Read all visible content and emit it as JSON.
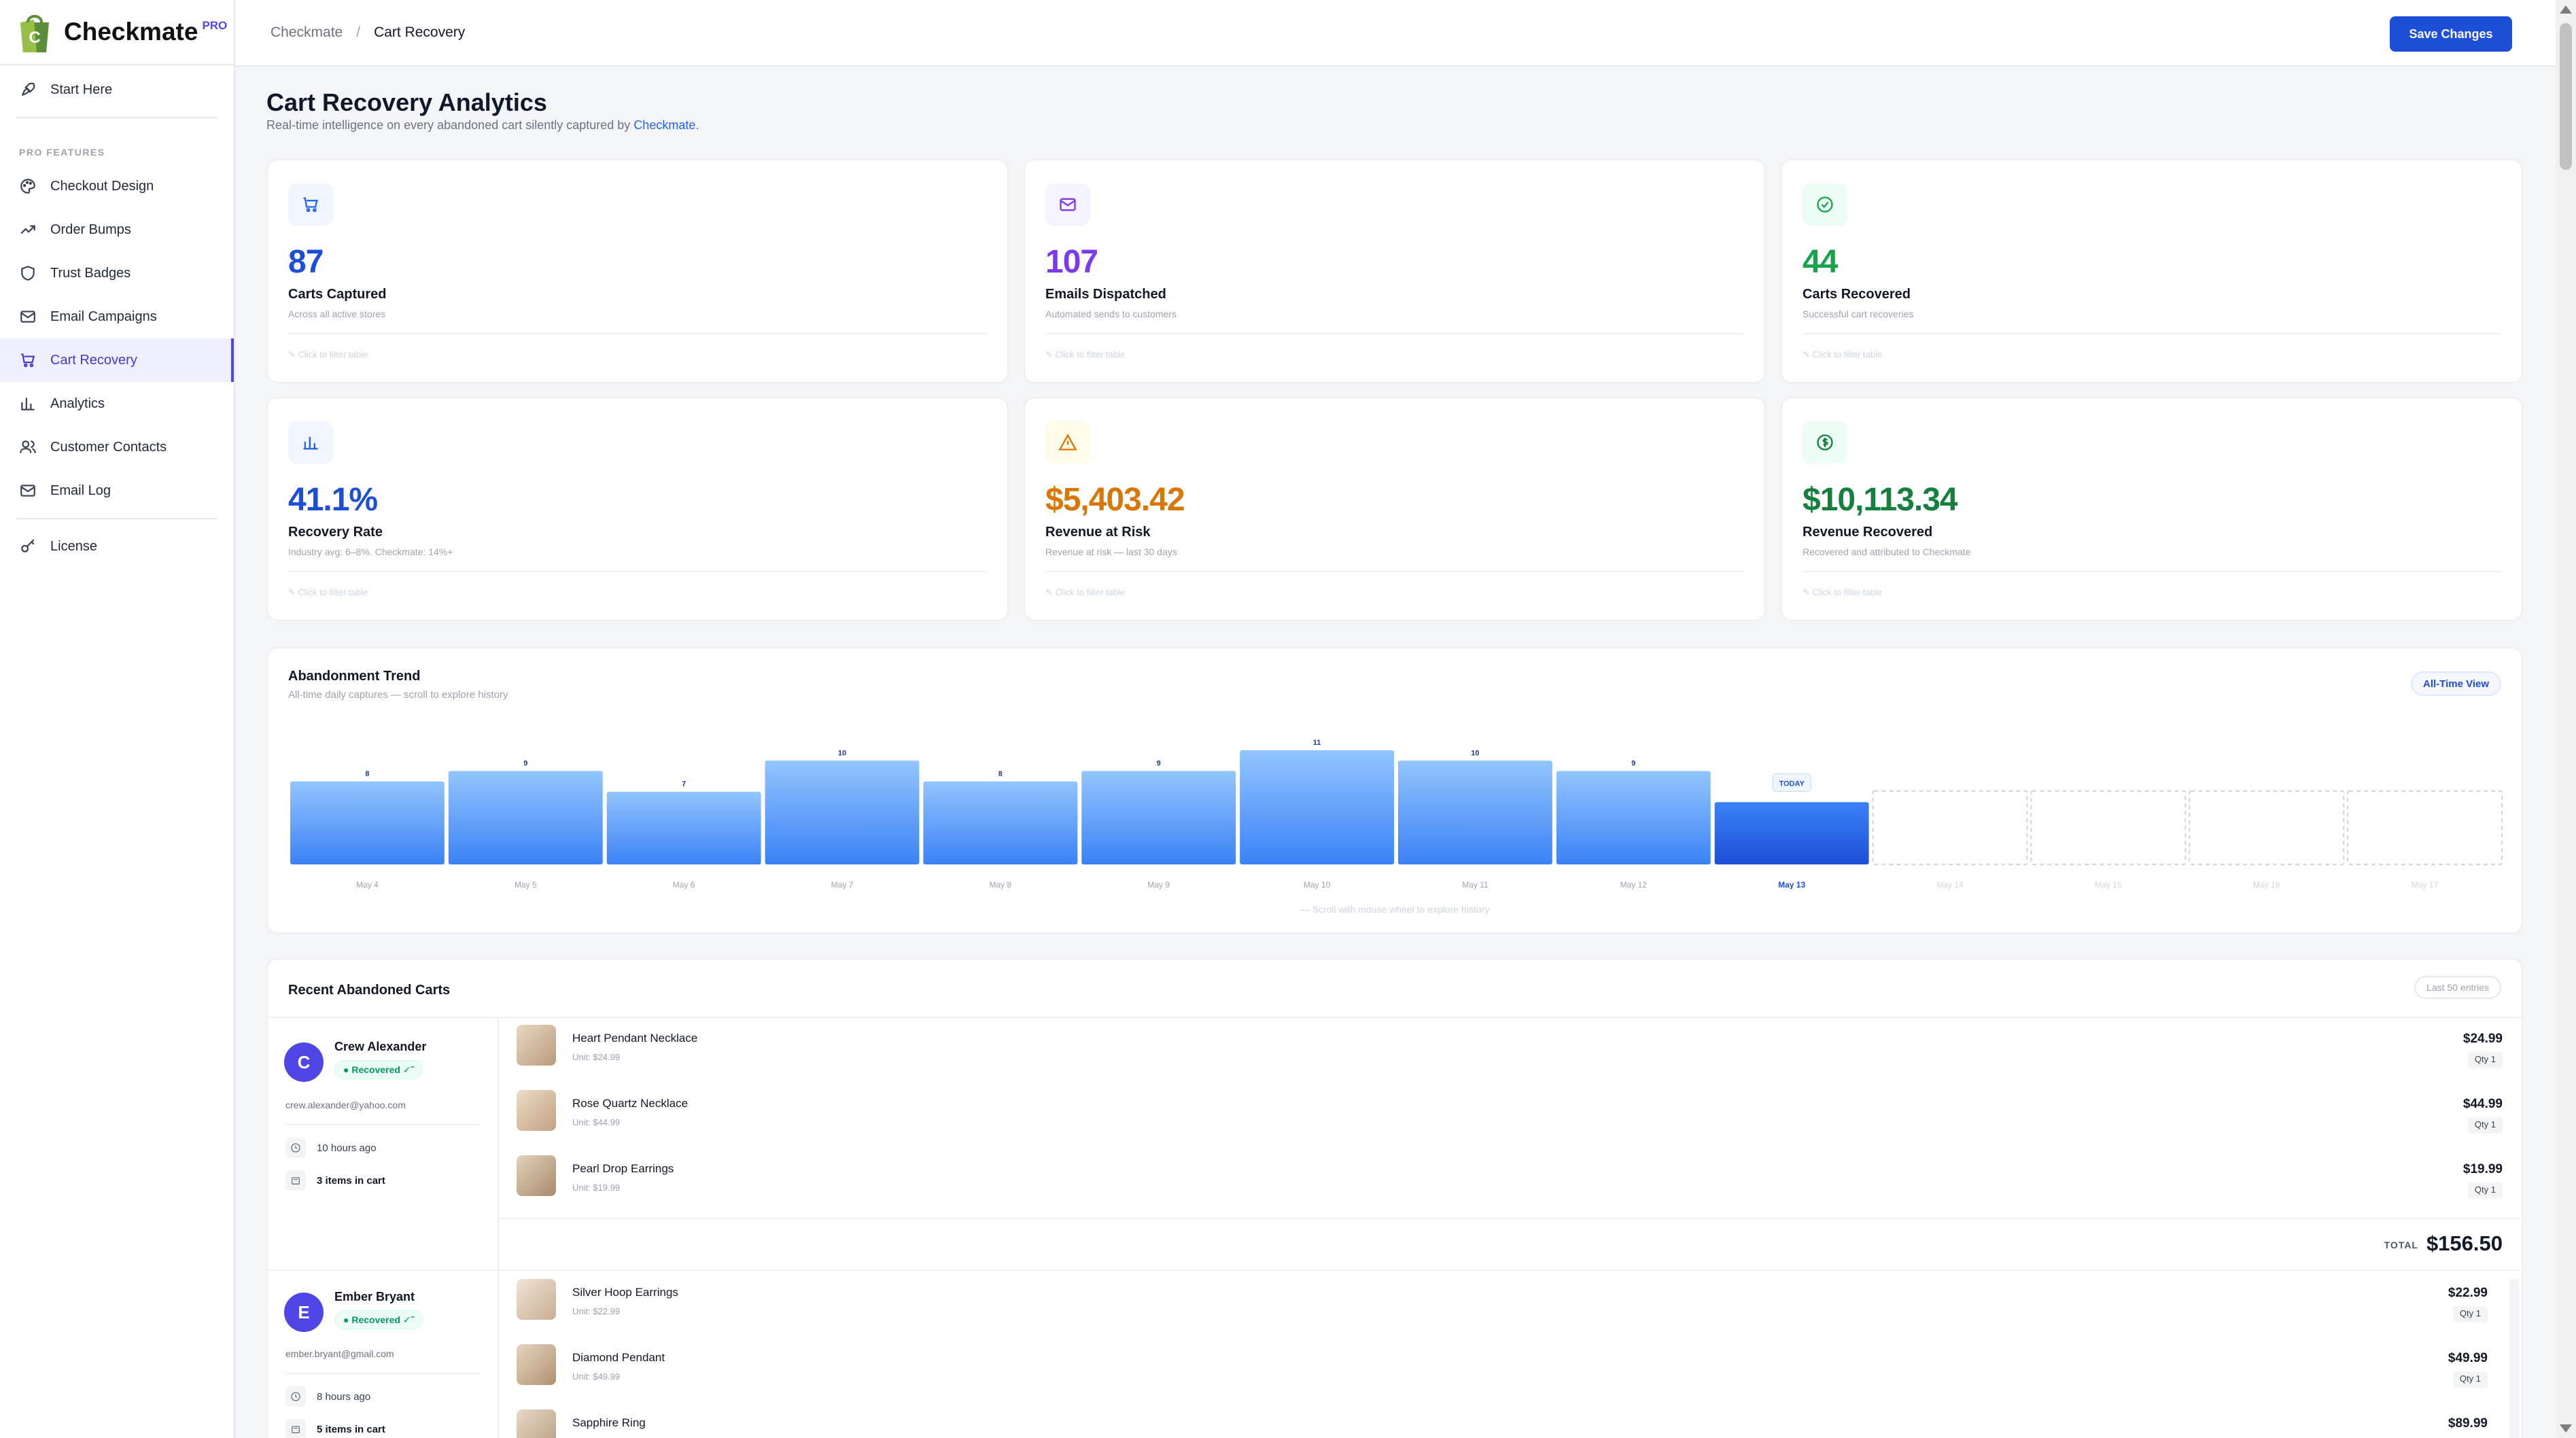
{
  "app": {
    "name": "Checkmate",
    "badge": "PRO"
  },
  "sidebar": {
    "start": "Start Here",
    "section": "PRO FEATURES",
    "items": [
      {
        "label": "Checkout Design",
        "icon": "palette-icon"
      },
      {
        "label": "Order Bumps",
        "icon": "trending-up-icon"
      },
      {
        "label": "Trust Badges",
        "icon": "shield-icon"
      },
      {
        "label": "Email Campaigns",
        "icon": "mail-icon"
      },
      {
        "label": "Cart Recovery",
        "icon": "cart-icon",
        "active": true
      },
      {
        "label": "Analytics",
        "icon": "bar-chart-icon"
      },
      {
        "label": "Customer Contacts",
        "icon": "users-icon"
      },
      {
        "label": "Email Log",
        "icon": "mail-icon"
      }
    ],
    "license": "License"
  },
  "topbar": {
    "crumb_root": "Checkmate",
    "crumb_sep": "/",
    "crumb_current": "Cart Recovery",
    "save_label": "Save Changes"
  },
  "page": {
    "title": "Cart Recovery Analytics",
    "subtitle_prefix": "Real-time intelligence on every abandoned cart silently captured by ",
    "subtitle_link": "Checkmate",
    "subtitle_suffix": "."
  },
  "stats": [
    {
      "value": "87",
      "label": "Carts Captured",
      "sub": "Across all active stores",
      "hint": "✎ Click to filter table",
      "color": "#1d4ed8",
      "icon": "cart-icon"
    },
    {
      "value": "107",
      "label": "Emails Dispatched",
      "sub": "Automated sends to customers",
      "hint": "✎ Click to filter table",
      "color": "#7c3aed",
      "icon": "mail-icon"
    },
    {
      "value": "44",
      "label": "Carts Recovered",
      "sub": "Successful cart recoveries",
      "hint": "✎ Click to filter table",
      "color": "#16a34a",
      "icon": "check-circle-icon"
    },
    {
      "value": "41.1%",
      "label": "Recovery Rate",
      "sub": "Industry avg: 6–8%. Checkmate: 14%+",
      "hint": "✎ Click to filter table",
      "color": "#1d4ed8",
      "icon": "bar-chart-icon"
    },
    {
      "value": "$5,403.42",
      "label": "Revenue at Risk",
      "sub": "Revenue at risk — last 30 days",
      "hint": "✎ Click to filter table",
      "color": "#d97706",
      "icon": "warning-icon"
    },
    {
      "value": "$10,113.34",
      "label": "Revenue Recovered",
      "sub": "Recovered and attributed to Checkmate",
      "hint": "✎ Click to filter table",
      "color": "#15803d",
      "icon": "dollar-icon"
    }
  ],
  "trend": {
    "title": "Abandonment Trend",
    "subtitle": "All-time daily captures — scroll to explore history",
    "view_label": "All-Time View",
    "scroll_hint": "— Scroll with mouse wheel to explore history",
    "today_label": "TODAY"
  },
  "chart_data": {
    "type": "bar",
    "categories": [
      "May 4",
      "May 5",
      "May 6",
      "May 7",
      "May 8",
      "May 9",
      "May 10",
      "May 11",
      "May 12",
      "May 13",
      "May 14",
      "May 15",
      "May 16",
      "May 17"
    ],
    "values": [
      8,
      9,
      7,
      10,
      8,
      9,
      11,
      10,
      9,
      6,
      null,
      null,
      null,
      null
    ],
    "labels": [
      "8",
      "9",
      "7",
      "10",
      "8",
      "9",
      "11",
      "10",
      "9",
      "",
      "",
      "",
      "",
      ""
    ],
    "today_index": 9,
    "ylim": [
      0,
      11
    ]
  },
  "recent": {
    "title": "Recent Abandoned Carts",
    "badge": "Last 50 entries",
    "total_label": "TOTAL"
  },
  "customers": [
    {
      "initial": "C",
      "name": "Crew Alexander",
      "status": "● Recovered ✓˜",
      "email": "crew.alexander@yahoo.com",
      "time": "10 hours ago",
      "count": "3 items in cart",
      "total": "$156.50",
      "items": [
        {
          "name": "Heart Pendant Necklace",
          "unit": "Unit: $24.99",
          "price": "$24.99",
          "qty": "Qty 1"
        },
        {
          "name": "Rose Quartz Necklace",
          "unit": "Unit: $44.99",
          "price": "$44.99",
          "qty": "Qty 1"
        },
        {
          "name": "Pearl Drop Earrings",
          "unit": "Unit: $19.99",
          "price": "$19.99",
          "qty": "Qty 1"
        }
      ]
    },
    {
      "initial": "E",
      "name": "Ember Bryant",
      "status": "● Recovered ✓˜",
      "email": "ember.bryant@gmail.com",
      "time": "8 hours ago",
      "count": "5 items in cart",
      "items": [
        {
          "name": "Silver Hoop Earrings",
          "unit": "Unit: $22.99",
          "price": "$22.99",
          "qty": "Qty 1"
        },
        {
          "name": "Diamond Pendant",
          "unit": "Unit: $49.99",
          "price": "$49.99",
          "qty": "Qty 1"
        },
        {
          "name": "Sapphire Ring",
          "unit": "",
          "price": "$89.99",
          "qty": ""
        }
      ]
    }
  ]
}
